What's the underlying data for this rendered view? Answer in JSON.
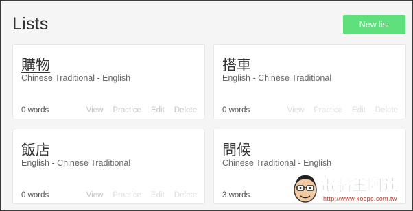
{
  "header": {
    "title": "Lists",
    "new_list_label": "New list"
  },
  "lists": [
    {
      "name": "購物",
      "languages": "Chinese Traditional - English",
      "count": "0 words",
      "actions": [
        "View",
        "Practice",
        "Edit",
        "Delete"
      ]
    },
    {
      "name": "搭車",
      "languages": "English - Chinese Traditional",
      "count": "0 words",
      "actions": [
        "View",
        "Practice",
        "Edit",
        "Delete"
      ]
    },
    {
      "name": "飯店",
      "languages": "English - Chinese Traditional",
      "count": "0 words",
      "actions": [
        "View",
        "Practice",
        "Edit",
        "Delete"
      ]
    },
    {
      "name": "問候",
      "languages": "Chinese Traditional - English",
      "count": "3 words",
      "actions": [
        "View",
        "Practice",
        "Edit",
        "Delete"
      ]
    }
  ],
  "watermark": {
    "title": "電腦王阿達",
    "url": "http://www.kocpc.com.tw"
  },
  "colors": {
    "accent": "#5fe07d",
    "background": "#f5f5f5",
    "card": "#ffffff",
    "muted_action": "#c4c4c4"
  }
}
